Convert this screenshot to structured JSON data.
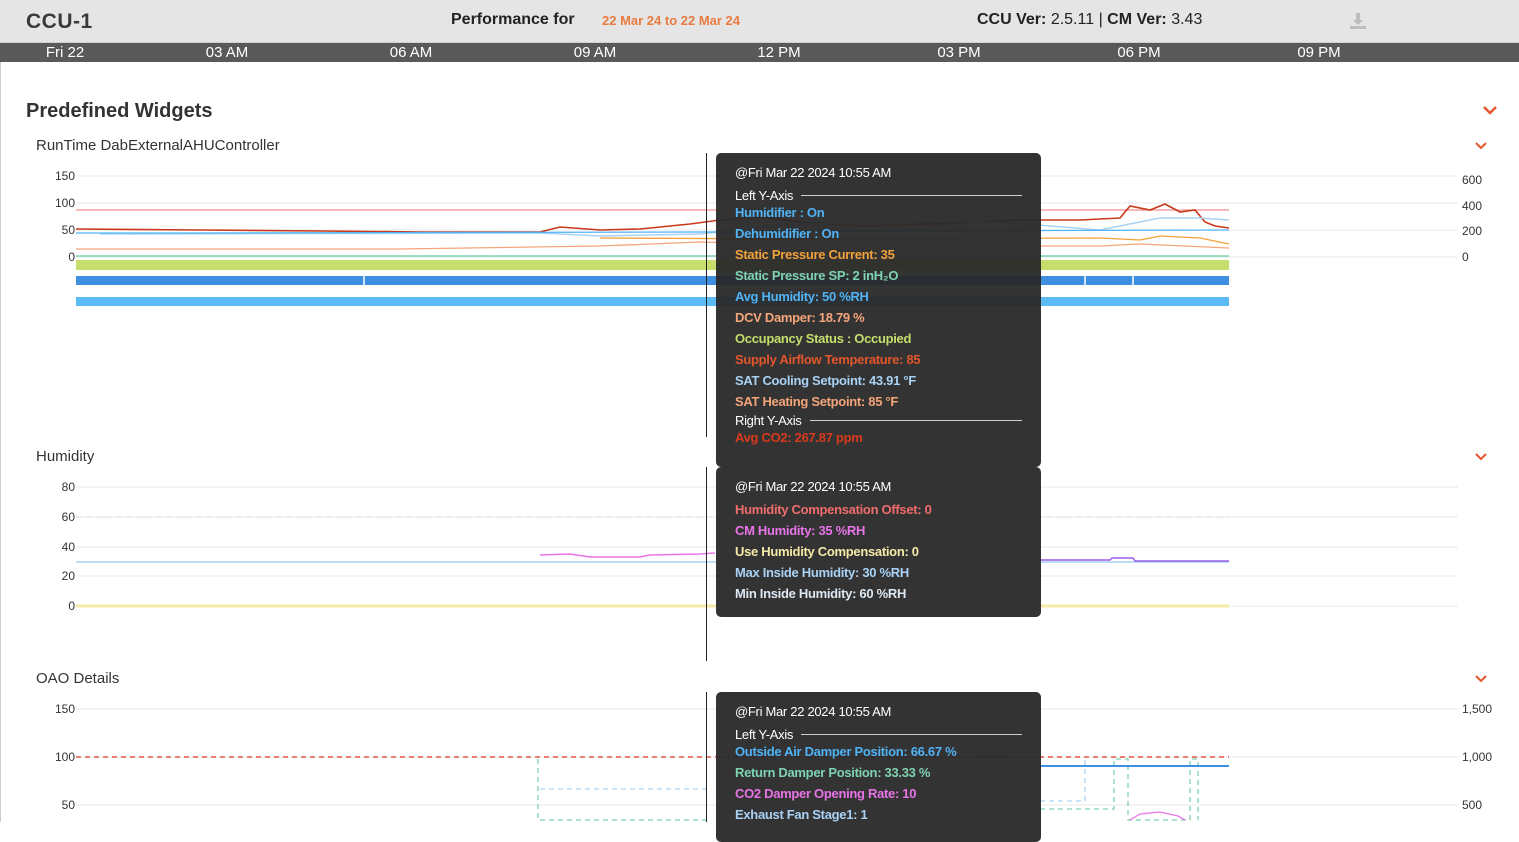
{
  "header": {
    "device": "CCU-1",
    "performance_label": "Performance for",
    "date_range": "22 Mar 24 to 22 Mar 24",
    "ccu_ver_label": "CCU Ver:",
    "ccu_ver": "2.5.11",
    "separator": "|",
    "cm_ver_label": "CM Ver:",
    "cm_ver": "3.43",
    "download_icon": "download-icon"
  },
  "timeline": [
    "Fri 22",
    "03 AM",
    "06 AM",
    "09 AM",
    "12 PM",
    "03 PM",
    "06 PM",
    "09 PM"
  ],
  "section": {
    "title": "Predefined Widgets",
    "collapse_icon": "chevron-down-icon"
  },
  "widgets": [
    {
      "title": "RunTime DabExternalAHUController",
      "left_ticks": [
        "150",
        "100",
        "50",
        "0"
      ],
      "right_ticks": [
        "600",
        "400",
        "200",
        "0"
      ],
      "tooltip": {
        "time": "@Fri Mar 22 2024 10:55 AM",
        "left_axis": "Left Y-Axis",
        "right_axis": "Right Y-Axis",
        "rows": [
          {
            "text": "Humidifier : On",
            "color": "#4fb3f6"
          },
          {
            "text": "Dehumidifier : On",
            "color": "#4fb3f6"
          },
          {
            "text": "Static Pressure Current: 35",
            "color": "#f3a13b"
          },
          {
            "text": "Static Pressure SP: 2 inH₂O",
            "color": "#7ed3b2"
          },
          {
            "text": "Avg Humidity: 50 %RH",
            "color": "#4fb3f6"
          },
          {
            "text": "DCV Damper: 18.79 %",
            "color": "#f4a57a"
          },
          {
            "text": "Occupancy Status : Occupied",
            "color": "#c6de6b"
          },
          {
            "text": "Supply Airflow Temperature: 85",
            "color": "#e2562a"
          },
          {
            "text": "SAT Cooling Setpoint: 43.91 °F",
            "color": "#a9d2f5"
          },
          {
            "text": "SAT Heating Setpoint: 85 °F",
            "color": "#f4a57a"
          }
        ],
        "right_rows": [
          {
            "text": "Avg CO2: 267.87 ppm",
            "color": "#d8391c"
          }
        ]
      }
    },
    {
      "title": "Humidity",
      "left_ticks": [
        "80",
        "60",
        "40",
        "20",
        "0"
      ],
      "tooltip": {
        "time": "@Fri Mar 22 2024 10:55 AM",
        "rows": [
          {
            "text": "Humidity Compensation Offset: 0",
            "color": "#f26c6c"
          },
          {
            "text": "CM Humidity: 35 %RH",
            "color": "#e874e8"
          },
          {
            "text": "Use Humidity Compensation: 0",
            "color": "#f5e9a8"
          },
          {
            "text": "Max Inside Humidity: 30 %RH",
            "color": "#a9d2f5"
          },
          {
            "text": "Min Inside Humidity: 60 %RH",
            "color": "#dde8f2"
          }
        ]
      }
    },
    {
      "title": "OAO Details",
      "left_ticks": [
        "150",
        "100",
        "50"
      ],
      "right_ticks": [
        "1,500",
        "1,000",
        "500"
      ],
      "tooltip": {
        "time": "@Fri Mar 22 2024 10:55 AM",
        "left_axis": "Left Y-Axis",
        "rows": [
          {
            "text": "Outside Air Damper Position: 66.67 %",
            "color": "#4fb3f6"
          },
          {
            "text": "Return Damper Position: 33.33 %",
            "color": "#7ed3b2"
          },
          {
            "text": "CO2 Damper Opening Rate: 10",
            "color": "#e874e8"
          },
          {
            "text": "Exhaust Fan Stage1: 1",
            "color": "#a9d2f5"
          }
        ]
      }
    }
  ]
}
